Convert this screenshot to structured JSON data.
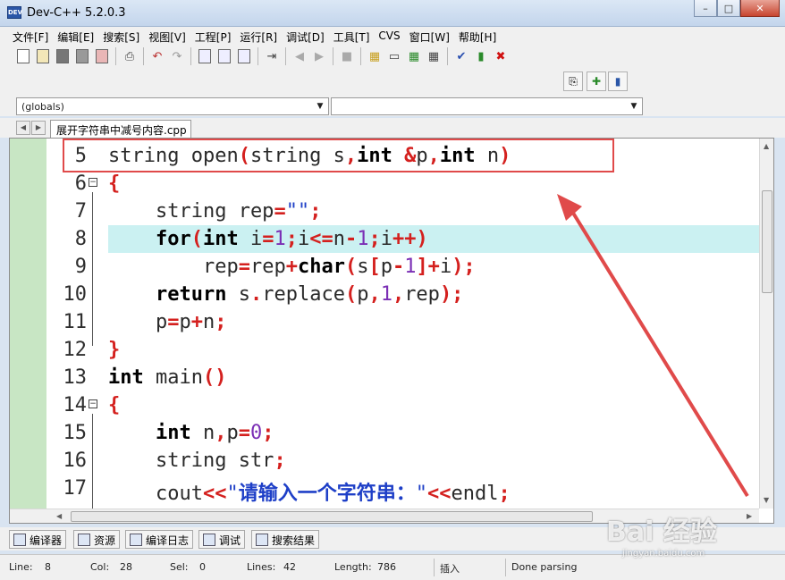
{
  "window": {
    "title": "Dev-C++ 5.2.0.3",
    "icon_text": "DEV"
  },
  "menu": [
    "文件[F]",
    "编辑[E]",
    "搜索[S]",
    "视图[V]",
    "工程[P]",
    "运行[R]",
    "调试[D]",
    "工具[T]",
    "CVS",
    "窗口[W]",
    "帮助[H]"
  ],
  "toolbar": {
    "icons": [
      "new-file-icon",
      "open-file-icon",
      "save-icon",
      "save-all-icon",
      "close-icon",
      "print-icon",
      "undo-icon",
      "redo-icon",
      "find-icon",
      "replace-icon",
      "find-next-icon",
      "goto-line-icon",
      "back-icon",
      "forward-icon",
      "stop-icon",
      "grid-icon",
      "window-icon",
      "compile-icon",
      "run-icon",
      "check-icon",
      "chart-icon",
      "delete-icon"
    ]
  },
  "combos": {
    "scope": "(globals)",
    "member": ""
  },
  "file_tab": "展开字符串中减号内容.cpp",
  "code": [
    {
      "ln": "5",
      "fold": "",
      "tokens": [
        [
          "t",
          "string open"
        ],
        [
          "op",
          "("
        ],
        [
          "t",
          "string s"
        ],
        [
          "op",
          ","
        ],
        [
          "kw",
          "int"
        ],
        [
          "t",
          " "
        ],
        [
          "op",
          "&"
        ],
        [
          "t",
          "p"
        ],
        [
          "op",
          ","
        ],
        [
          "kw",
          "int"
        ],
        [
          "t",
          " n"
        ],
        [
          "op",
          ")"
        ]
      ]
    },
    {
      "ln": "6",
      "fold": "⊟",
      "tokens": [
        [
          "op",
          "{"
        ]
      ]
    },
    {
      "ln": "7",
      "fold": "",
      "tokens": [
        [
          "t",
          "    string rep"
        ],
        [
          "op",
          "="
        ],
        [
          "str",
          "\"\""
        ],
        [
          "op",
          ";"
        ]
      ]
    },
    {
      "ln": "8",
      "fold": "",
      "highlight": true,
      "tokens": [
        [
          "t",
          "    "
        ],
        [
          "kw",
          "for"
        ],
        [
          "op",
          "("
        ],
        [
          "kw",
          "int"
        ],
        [
          "t",
          " i"
        ],
        [
          "op",
          "="
        ],
        [
          "num",
          "1"
        ],
        [
          "op",
          ";"
        ],
        [
          "t",
          "i"
        ],
        [
          "op",
          "<="
        ],
        [
          "t",
          "n"
        ],
        [
          "op",
          "-"
        ],
        [
          "num",
          "1"
        ],
        [
          "op",
          ";"
        ],
        [
          "t",
          "i"
        ],
        [
          "op",
          "++)"
        ]
      ]
    },
    {
      "ln": "9",
      "fold": "",
      "tokens": [
        [
          "t",
          "        rep"
        ],
        [
          "op",
          "="
        ],
        [
          "t",
          "rep"
        ],
        [
          "op",
          "+"
        ],
        [
          "kw",
          "char"
        ],
        [
          "op",
          "("
        ],
        [
          "t",
          "s"
        ],
        [
          "op",
          "["
        ],
        [
          "t",
          "p"
        ],
        [
          "op",
          "-"
        ],
        [
          "num",
          "1"
        ],
        [
          "op",
          "]+"
        ],
        [
          "t",
          "i"
        ],
        [
          "op",
          ");"
        ]
      ]
    },
    {
      "ln": "10",
      "fold": "",
      "tokens": [
        [
          "t",
          "    "
        ],
        [
          "kw",
          "return"
        ],
        [
          "t",
          " s"
        ],
        [
          "op",
          "."
        ],
        [
          "t",
          "replace"
        ],
        [
          "op",
          "("
        ],
        [
          "t",
          "p"
        ],
        [
          "op",
          ","
        ],
        [
          "num",
          "1"
        ],
        [
          "op",
          ","
        ],
        [
          "t",
          "rep"
        ],
        [
          "op",
          ");"
        ]
      ]
    },
    {
      "ln": "11",
      "fold": "",
      "tokens": [
        [
          "t",
          "    p"
        ],
        [
          "op",
          "="
        ],
        [
          "t",
          "p"
        ],
        [
          "op",
          "+"
        ],
        [
          "t",
          "n"
        ],
        [
          "op",
          ";"
        ]
      ]
    },
    {
      "ln": "12",
      "fold": "",
      "tokens": [
        [
          "op",
          "}"
        ]
      ]
    },
    {
      "ln": "13",
      "fold": "",
      "tokens": [
        [
          "kw",
          "int"
        ],
        [
          "t",
          " main"
        ],
        [
          "op",
          "()"
        ]
      ]
    },
    {
      "ln": "14",
      "fold": "⊟",
      "tokens": [
        [
          "op",
          "{"
        ]
      ]
    },
    {
      "ln": "15",
      "fold": "",
      "tokens": [
        [
          "t",
          "    "
        ],
        [
          "kw",
          "int"
        ],
        [
          "t",
          " n"
        ],
        [
          "op",
          ","
        ],
        [
          "t",
          "p"
        ],
        [
          "op",
          "="
        ],
        [
          "num",
          "0"
        ],
        [
          "op",
          ";"
        ]
      ]
    },
    {
      "ln": "16",
      "fold": "",
      "tokens": [
        [
          "t",
          "    string str"
        ],
        [
          "op",
          ";"
        ]
      ]
    },
    {
      "ln": "17",
      "fold": "",
      "tokens": [
        [
          "t",
          "    cout"
        ],
        [
          "op",
          "<<"
        ],
        [
          "str",
          "\""
        ],
        [
          "cjk",
          "请输入一个字符串："
        ],
        [
          "str",
          "\""
        ],
        [
          "op",
          "<<"
        ],
        [
          "t",
          "endl"
        ],
        [
          "op",
          ";"
        ]
      ]
    }
  ],
  "bottom_tabs": [
    "编译器",
    "资源",
    "编译日志",
    "调试",
    "搜索结果"
  ],
  "status": {
    "line_label": "Line:",
    "line": "8",
    "col_label": "Col:",
    "col": "28",
    "sel_label": "Sel:",
    "sel": "0",
    "lines_label": "Lines:",
    "lines": "42",
    "length_label": "Length:",
    "length": "786",
    "mode": "插入",
    "message": "Done parsing"
  },
  "watermark": {
    "brand": "Bai 经验",
    "sub": "jingyan.baidu.com"
  },
  "colors": {
    "annotation_red": "#e04a4a",
    "highlight_line": "#cbf1f2",
    "gutter_green": "#c8e6c4"
  }
}
